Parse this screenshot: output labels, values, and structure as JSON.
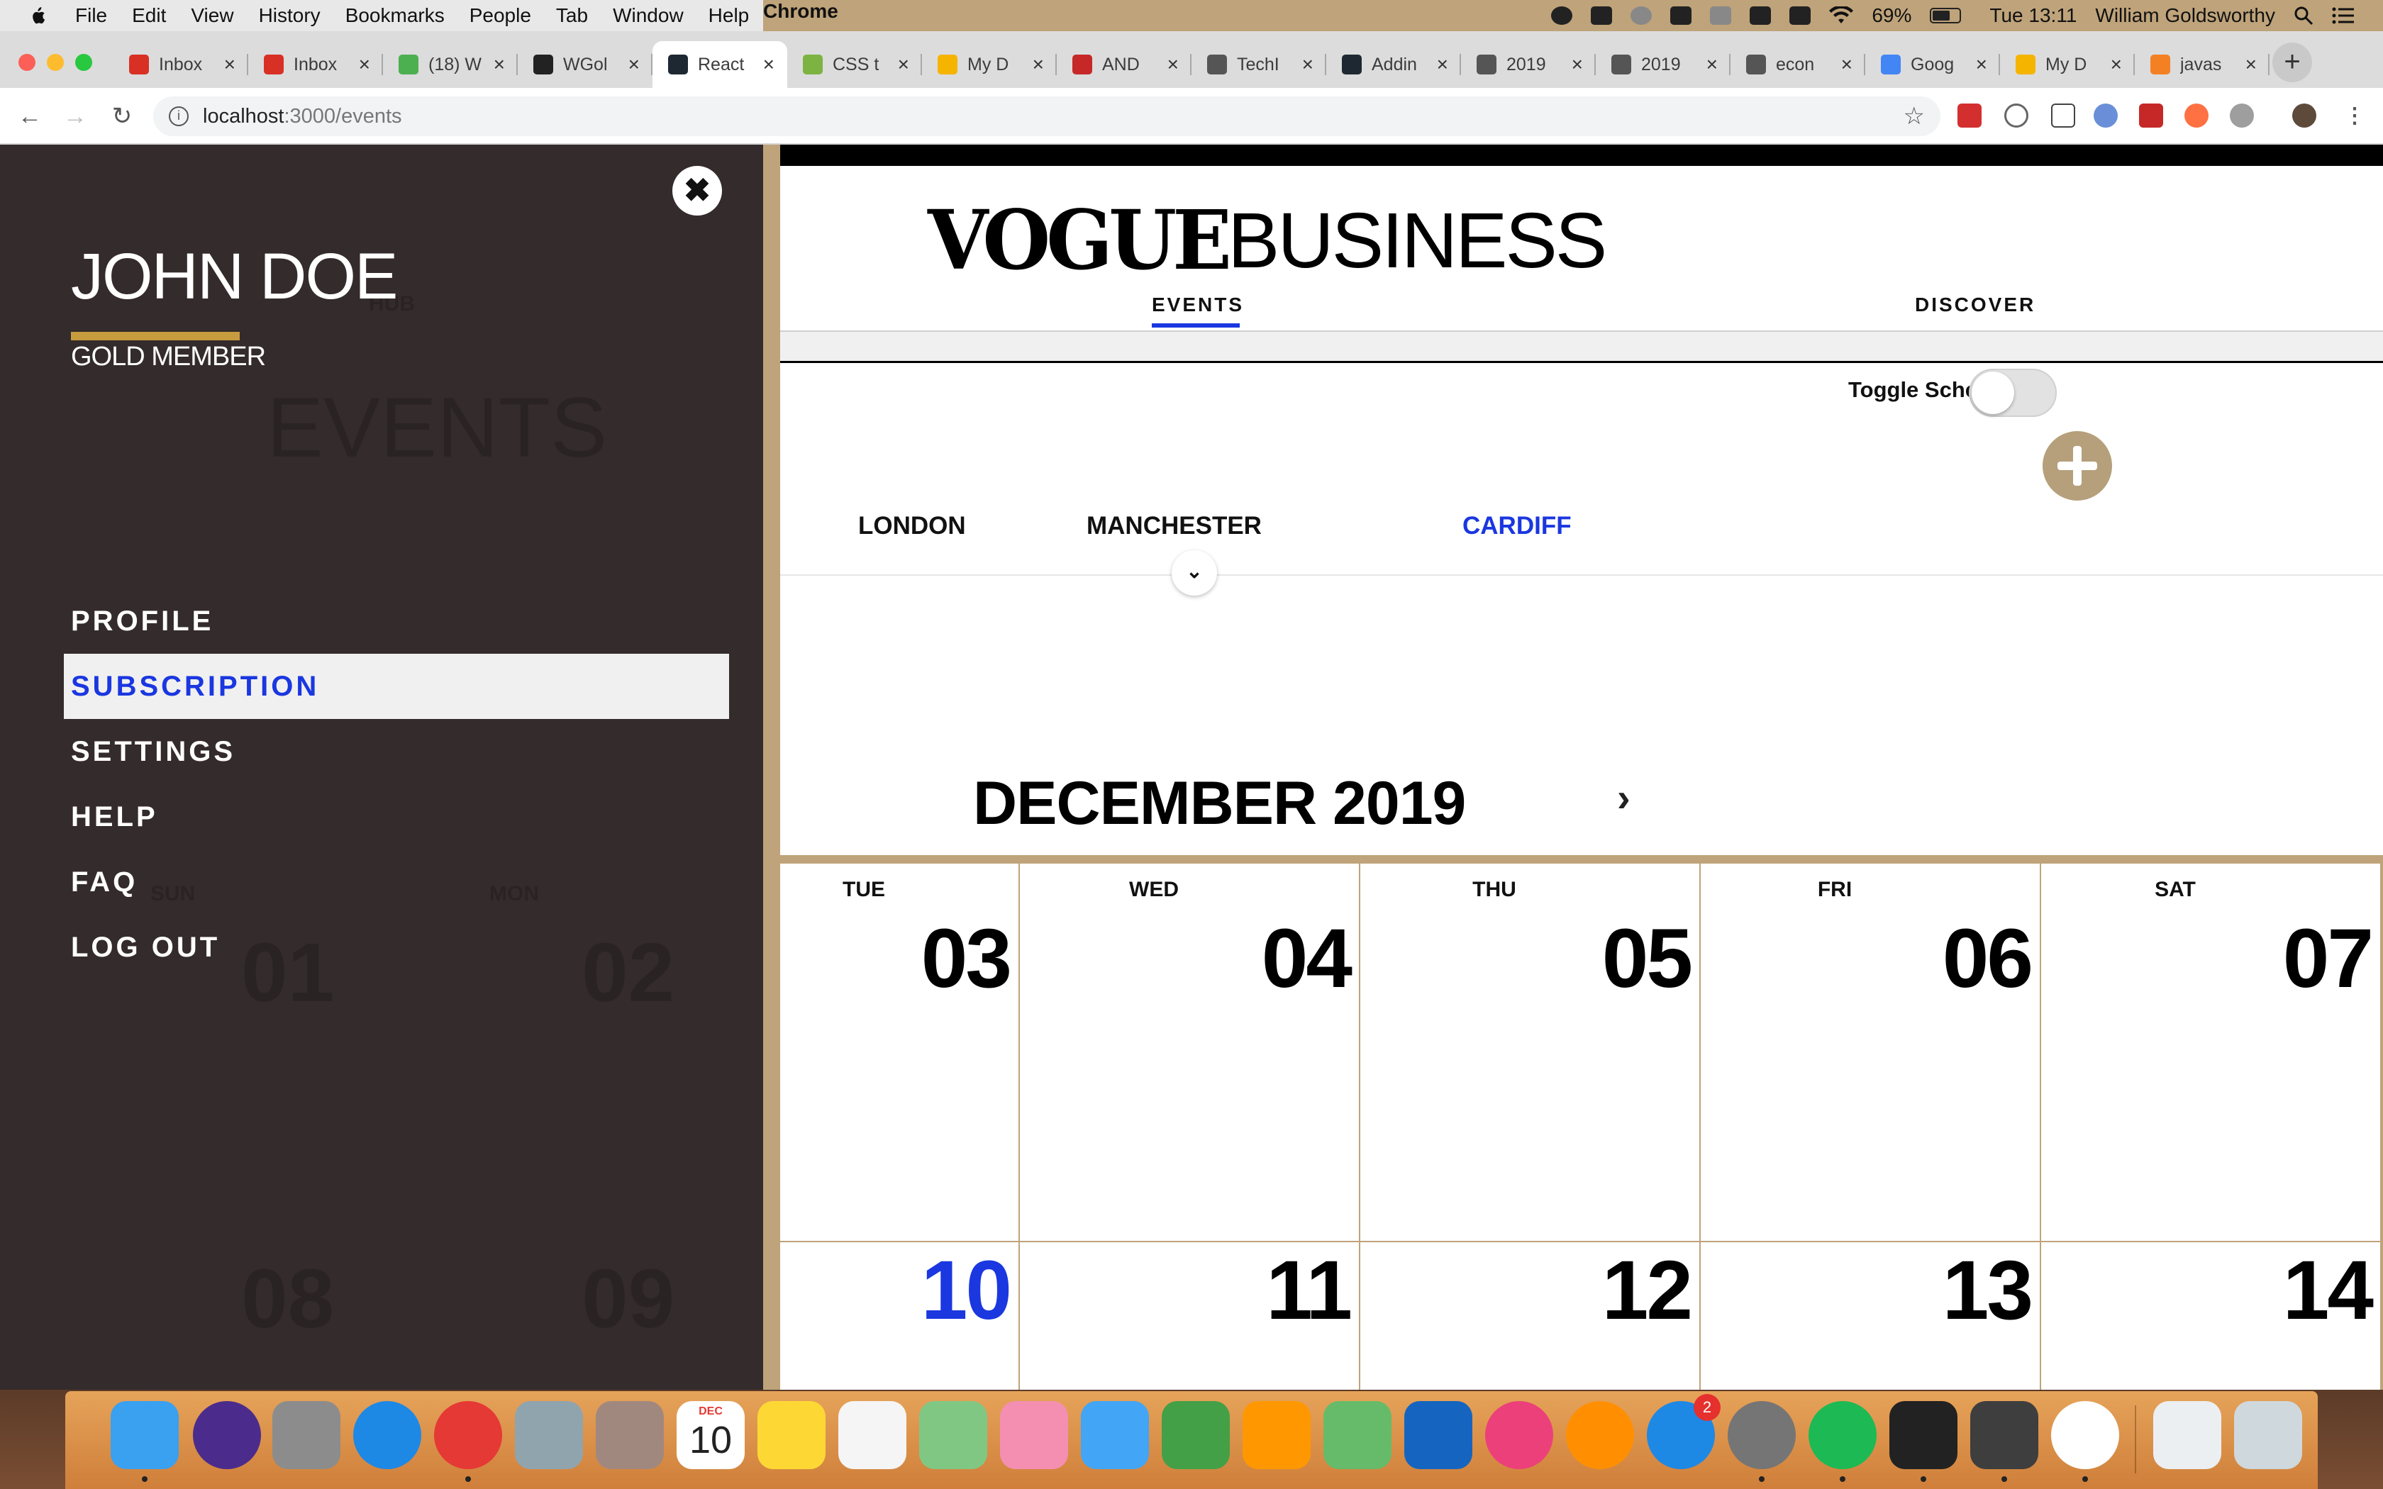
{
  "menubar": {
    "app_name": "Chrome",
    "items": [
      "File",
      "Edit",
      "View",
      "History",
      "Bookmarks",
      "People",
      "Tab",
      "Window",
      "Help"
    ],
    "battery": "69%",
    "clock": "Tue 13:11",
    "user": "William Goldsworthy"
  },
  "browser": {
    "tabs": [
      {
        "title": "Inbox",
        "color": "#d93025"
      },
      {
        "title": "Inbox",
        "color": "#d93025"
      },
      {
        "title": "(18) W",
        "color": "#4caf50"
      },
      {
        "title": "WGol",
        "color": "#222222"
      },
      {
        "title": "React",
        "color": "#1e2833"
      },
      {
        "title": "CSS t",
        "color": "#7cb342"
      },
      {
        "title": "My D",
        "color": "#f4b400"
      },
      {
        "title": "AND",
        "color": "#c62828"
      },
      {
        "title": "TechI",
        "color": "#555555"
      },
      {
        "title": "Addin",
        "color": "#1e2833"
      },
      {
        "title": "2019",
        "color": "#555555"
      },
      {
        "title": "2019",
        "color": "#555555"
      },
      {
        "title": "econ",
        "color": "#555555"
      },
      {
        "title": "Goog",
        "color": "#4285f4"
      },
      {
        "title": "My D",
        "color": "#f4b400"
      },
      {
        "title": "javas",
        "color": "#f48024"
      }
    ],
    "active_tab_index": 4,
    "url_host": "localhost",
    "url_path": ":3000/events"
  },
  "drawer": {
    "user_name": "JOHN DOE",
    "tier": "GOLD MEMBER",
    "menu": [
      {
        "label": "PROFILE",
        "active": false
      },
      {
        "label": "SUBSCRIPTION",
        "active": true
      },
      {
        "label": "SETTINGS",
        "active": false
      },
      {
        "label": "HELP",
        "active": false
      },
      {
        "label": "FAQ",
        "active": false
      },
      {
        "label": "LOG OUT",
        "active": false
      }
    ],
    "ghost_text": {
      "events": "EVENTS",
      "hub": "HUB",
      "sun": "SUN",
      "mon": "MON",
      "d1": "01",
      "d2": "02",
      "d8": "08",
      "d9": "09"
    }
  },
  "header": {
    "logo_part1": "VOGUE",
    "logo_part2": "BUSINESS",
    "nav_events": "EVENTS",
    "nav_discover": "DISCOVER"
  },
  "cities": [
    "LONDON",
    "MANCHESTER",
    "CARDIFF"
  ],
  "selected_city": "CARDIFF",
  "scheduler": {
    "label": "Toggle Scheduler",
    "enabled": false
  },
  "calendar": {
    "month_title": "DECEMBER 2019",
    "weekdays": [
      "TUE",
      "WED",
      "THU",
      "FRI",
      "SAT"
    ],
    "week1": [
      "03",
      "04",
      "05",
      "06",
      "07"
    ],
    "week2": [
      "10",
      "11",
      "12",
      "13",
      "14"
    ],
    "today": "10"
  },
  "dock": {
    "calendar_month": "DEC",
    "calendar_day": "10",
    "appstore_badge": "2"
  },
  "colors": {
    "accent_blue": "#1a37e0",
    "gold": "#c69c3e",
    "drawer_bg": "#342b2c",
    "frame_tan": "#bfa37a"
  }
}
